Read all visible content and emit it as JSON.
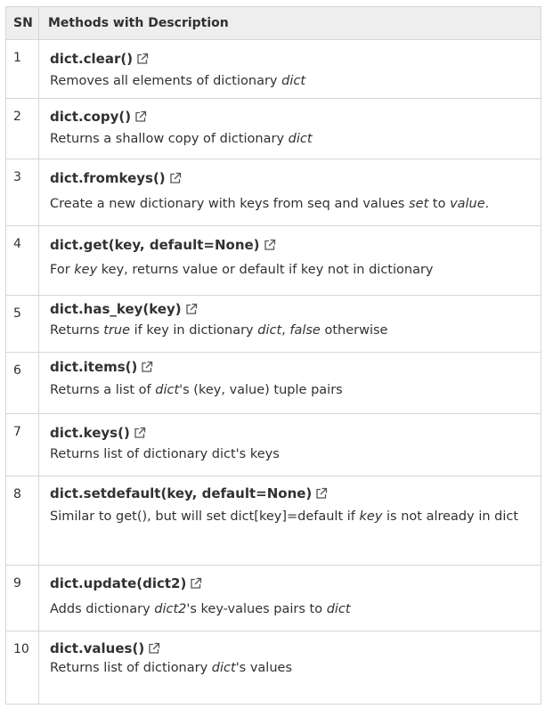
{
  "header": {
    "sn": "SN",
    "methods": "Methods with Description"
  },
  "rows": [
    {
      "sn": "1",
      "method": "dict.clear()",
      "desc": [
        {
          "t": "Removes all elements of dictionary "
        },
        {
          "t": "dict",
          "i": true
        }
      ]
    },
    {
      "sn": "2",
      "method": "dict.copy()",
      "desc": [
        {
          "t": "Returns a shallow copy of dictionary "
        },
        {
          "t": "dict",
          "i": true
        }
      ]
    },
    {
      "sn": "3",
      "method": "dict.fromkeys()",
      "desc": [
        {
          "t": "Create a new dictionary with keys from seq and values "
        },
        {
          "t": "set",
          "i": true
        },
        {
          "t": " to "
        },
        {
          "t": "value",
          "i": true
        },
        {
          "t": "."
        }
      ]
    },
    {
      "sn": "4",
      "method": "dict.get(key, default=None)",
      "desc": [
        {
          "t": "For "
        },
        {
          "t": "key",
          "i": true
        },
        {
          "t": " key, returns value or default if key not in dictionary"
        }
      ]
    },
    {
      "sn": "5",
      "method": "dict.has_key(key)",
      "desc": [
        {
          "t": "Returns "
        },
        {
          "t": "true",
          "i": true
        },
        {
          "t": " if key in dictionary "
        },
        {
          "t": "dict",
          "i": true
        },
        {
          "t": ", "
        },
        {
          "t": "false",
          "i": true
        },
        {
          "t": " otherwise"
        }
      ]
    },
    {
      "sn": "6",
      "method": "dict.items()",
      "desc": [
        {
          "t": "Returns a list of "
        },
        {
          "t": "dict",
          "i": true
        },
        {
          "t": "'s (key, value) tuple pairs"
        }
      ]
    },
    {
      "sn": "7",
      "method": "dict.keys()",
      "desc": [
        {
          "t": "Returns list of dictionary dict's keys"
        }
      ]
    },
    {
      "sn": "8",
      "method": "dict.setdefault(key, default=None)",
      "desc": [
        {
          "t": "Similar to get(), but will set dict[key]=default if "
        },
        {
          "t": "key",
          "i": true
        },
        {
          "t": " is not already in dict"
        }
      ]
    },
    {
      "sn": "9",
      "method": "dict.update(dict2)",
      "desc": [
        {
          "t": "Adds dictionary "
        },
        {
          "t": "dict2",
          "i": true
        },
        {
          "t": "'s key-values pairs to "
        },
        {
          "t": "dict",
          "i": true
        }
      ]
    },
    {
      "sn": "10",
      "method": "dict.values()",
      "desc": [
        {
          "t": "Returns list of dictionary "
        },
        {
          "t": "dict",
          "i": true
        },
        {
          "t": "'s values"
        }
      ]
    }
  ]
}
